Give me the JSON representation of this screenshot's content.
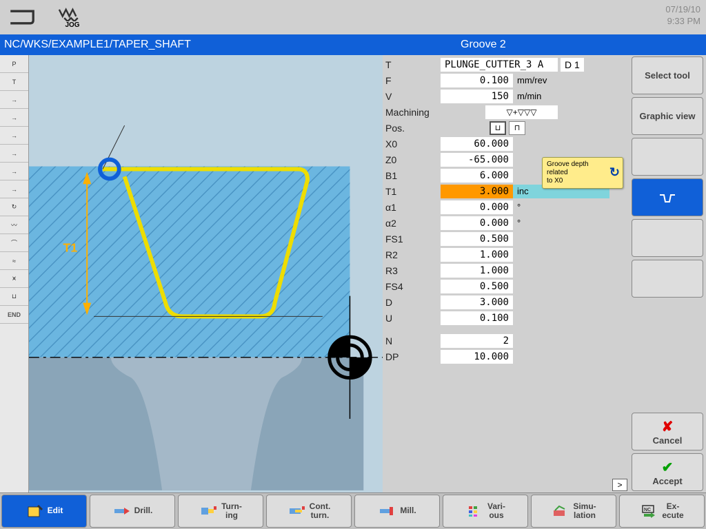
{
  "header": {
    "mode_label": "JOG",
    "date": "07/19/10",
    "time": "9:33 PM"
  },
  "title": {
    "path": "NC/WKS/EXAMPLE1/TAPER_SHAFT",
    "cycle": "Groove 2"
  },
  "params": {
    "tool": {
      "label": "T",
      "value": "PLUNGE_CUTTER_3 A",
      "d": "D 1"
    },
    "feed": {
      "label": "F",
      "value": "0.100",
      "unit": "mm/rev"
    },
    "speed": {
      "label": "V",
      "value": "150",
      "unit": "m/min"
    },
    "machining": {
      "label": "Machining",
      "symbol": "▽+▽▽▽"
    },
    "pos": {
      "label": "Pos."
    },
    "x0": {
      "label": "X0",
      "value": "60.000"
    },
    "z0": {
      "label": "Z0",
      "value": "-65.000"
    },
    "b1": {
      "label": "B1",
      "value": "6.000"
    },
    "t1": {
      "label": "T1",
      "value": "3.000",
      "unit": "inc"
    },
    "a1": {
      "label": "α1",
      "value": "0.000",
      "unit": "°"
    },
    "a2": {
      "label": "α2",
      "value": "0.000",
      "unit": "°"
    },
    "fs1": {
      "label": "FS1",
      "value": "0.500"
    },
    "r2": {
      "label": "R2",
      "value": "1.000"
    },
    "r3": {
      "label": "R3",
      "value": "1.000"
    },
    "fs4": {
      "label": "FS4",
      "value": "0.500"
    },
    "d": {
      "label": "D",
      "value": "3.000"
    },
    "u": {
      "label": "U",
      "value": "0.100"
    },
    "n": {
      "label": "N",
      "value": "2"
    },
    "dp": {
      "label": "DP",
      "value": "10.000"
    }
  },
  "tooltip": {
    "line1": "Groove depth",
    "line2": "related",
    "line3": "to X0"
  },
  "soft_keys": {
    "sk1": "Select tool",
    "sk2": "Graphic view",
    "cancel": "Cancel",
    "accept": "Accept"
  },
  "bottom": {
    "edit": "Edit",
    "drill": "Drill.",
    "turn": "Turn-\ning",
    "cont": "Cont.\nturn.",
    "mill": "Mill.",
    "vari": "Vari-\nous",
    "simu": "Simu-\nlation",
    "exec": "Ex-\necute"
  },
  "left_icons": [
    "P",
    "T",
    "→",
    "→",
    "→",
    "→",
    "→",
    "→",
    "↻",
    "〰",
    "⌒",
    "≈",
    "⩙",
    "⊔"
  ],
  "end_label": "END",
  "graphic_label": "T1"
}
